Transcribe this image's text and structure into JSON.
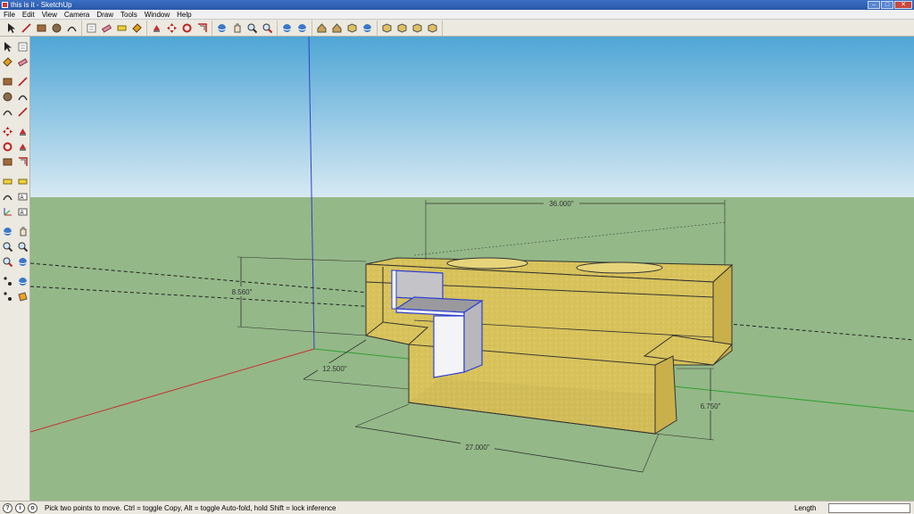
{
  "window": {
    "title": "this is it - SketchUp",
    "controls": {
      "minimize": "–",
      "maximize": "□",
      "close": "✕"
    }
  },
  "menu": {
    "items": [
      "File",
      "Edit",
      "View",
      "Camera",
      "Draw",
      "Tools",
      "Window",
      "Help"
    ]
  },
  "toolbar": {
    "groups": [
      [
        "select-tool",
        "line-tool",
        "rectangle-tool",
        "circle-tool",
        "arc-tool"
      ],
      [
        "make-component-tool",
        "eraser-tool",
        "tape-measure-tool",
        "paint-bucket-tool"
      ],
      [
        "push-pull-tool",
        "move-tool",
        "rotate-tool",
        "offset-tool"
      ],
      [
        "orbit-tool",
        "pan-tool",
        "zoom-tool",
        "zoom-extents-tool"
      ],
      [
        "previous-view",
        "next-view"
      ],
      [
        "get-models",
        "share-model",
        "share-component",
        "get-photo-texture"
      ],
      [
        "top-view",
        "front-view",
        "right-view",
        "iso-view"
      ]
    ]
  },
  "left_toolbar": {
    "rows": [
      [
        "select-tool",
        "make-component-tool"
      ],
      [
        "paint-bucket-tool",
        "eraser-tool"
      ],
      [
        "rectangle-tool",
        "line-tool"
      ],
      [
        "circle-tool",
        "arc-tool"
      ],
      [
        "polygon-tool",
        "freehand-tool"
      ],
      [
        "move-tool",
        "push-pull-tool"
      ],
      [
        "rotate-tool",
        "follow-me-tool"
      ],
      [
        "scale-tool",
        "offset-tool"
      ],
      [
        "tape-measure-tool",
        "dimension-tool"
      ],
      [
        "protractor-tool",
        "text-tool"
      ],
      [
        "axes-tool",
        "3d-text-tool"
      ],
      [
        "orbit-tool",
        "pan-tool"
      ],
      [
        "zoom-tool",
        "zoom-window-tool"
      ],
      [
        "zoom-extents-tool",
        "previous-view"
      ],
      [
        "position-camera-tool",
        "look-around-tool"
      ],
      [
        "walk-tool",
        "section-plane-tool"
      ]
    ]
  },
  "viewport": {
    "sky_color": "#c8dff0",
    "ground_color": "#94b888",
    "box_color": "#d8c25a",
    "dimensions": {
      "width_top": "36.000\"",
      "height_back": "8.560\"",
      "depth": "12.500\"",
      "width_bottom": "27.000\"",
      "height_front": "6.750\""
    }
  },
  "status": {
    "message": "Pick two points to move.  Ctrl = toggle Copy, Alt = toggle Auto-fold, hold Shift = lock inference",
    "length_label": "Length",
    "length_value": "",
    "icons": [
      "?",
      "i",
      "o"
    ]
  }
}
